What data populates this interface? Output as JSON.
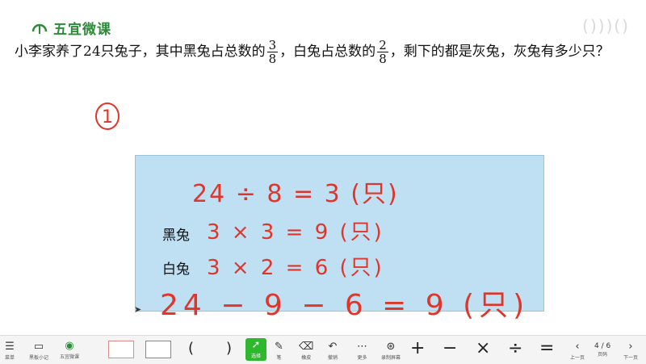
{
  "header": {
    "brand_name": "五宜微课",
    "corner_mark": "()))()"
  },
  "problem": {
    "part1": "小李家养了24只兔子，其中黑兔占总数的",
    "frac1": {
      "num": "3",
      "den": "8"
    },
    "part2": "，白兔占总数的",
    "frac2": {
      "num": "2",
      "den": "8"
    },
    "part3": "，剩下的都是灰兔，灰兔有多少只？"
  },
  "handwriting": {
    "circled_number": "1",
    "line1": "24 ÷ 8 = 3 (只)",
    "label_black": "黑兔",
    "line2": "3 × 3 = 9 (只)",
    "label_white": "白兔",
    "line3": "3 × 2 = 6 (只)",
    "line4": "24 − 9 − 6 = 9 (只)"
  },
  "toolbar": {
    "menu_label": "菜单",
    "blackboard_label": "黑板小记",
    "brand_label": "五宜微课",
    "paren_left": "(",
    "paren_right": ")",
    "select_label": "选择",
    "pen_label": "笔",
    "eraser_label": "橡皮",
    "undo_label": "撤销",
    "more_label": "更多",
    "screen_label": "录制屏幕",
    "op_plus": "+",
    "op_minus": "−",
    "op_times": "×",
    "op_div": "÷",
    "op_eq": "=",
    "prev_label": "上一页",
    "page_label": "页码",
    "page_value": "4 / 6",
    "next_label": "下一页"
  }
}
